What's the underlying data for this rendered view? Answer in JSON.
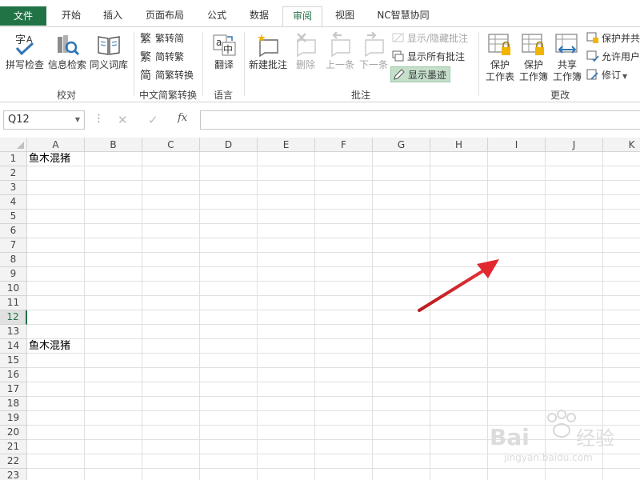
{
  "tabs": [
    {
      "label": "文件"
    },
    {
      "label": "开始"
    },
    {
      "label": "插入"
    },
    {
      "label": "页面布局"
    },
    {
      "label": "公式"
    },
    {
      "label": "数据"
    },
    {
      "label": "审阅"
    },
    {
      "label": "视图"
    },
    {
      "label": "NC智慧协同"
    }
  ],
  "ribbon": {
    "proofing": {
      "label": "校对",
      "spell": "拼写检查",
      "research": "信息检索",
      "thesaurus": "同义词库"
    },
    "chinese": {
      "label": "中文简繁转换",
      "to_simplified": "繁转简",
      "to_traditional": "简转繁",
      "convert": "简繁转换"
    },
    "language": {
      "label": "语言",
      "translate": "翻译"
    },
    "comments": {
      "label": "批注",
      "new": "新建批注",
      "delete": "删除",
      "prev": "上一条",
      "next": "下一条",
      "show_hide": "显示/隐藏批注",
      "show_all": "显示所有批注",
      "show_ink": "显示墨迹"
    },
    "changes": {
      "label": "更改",
      "protect_sheet": "保护\n工作表",
      "protect_sheet_1": "保护",
      "protect_sheet_2": "工作表",
      "protect_wb_1": "保护",
      "protect_wb_2": "工作簿",
      "share_wb_1": "共享",
      "share_wb_2": "工作簿",
      "protect_share": "保护并共",
      "allow_users": "允许用户",
      "track": "修订"
    }
  },
  "formula_bar": {
    "name_box": "Q12",
    "fx": "fx",
    "value": ""
  },
  "sheet": {
    "columns": [
      "A",
      "B",
      "C",
      "D",
      "E",
      "F",
      "G",
      "H",
      "I",
      "J",
      "K"
    ],
    "rows": [
      "1",
      "2",
      "3",
      "4",
      "5",
      "6",
      "7",
      "8",
      "9",
      "10",
      "11",
      "12",
      "13",
      "14",
      "15",
      "16",
      "17",
      "18",
      "19",
      "20",
      "21",
      "22",
      "23"
    ],
    "selected_row": "12",
    "cells": {
      "A1": "鱼木混猪",
      "A14": "鱼木混猪"
    }
  },
  "colors": {
    "accent": "#217346",
    "arrow": "#d9262c",
    "ink_pressed": "#c5dfcb"
  }
}
